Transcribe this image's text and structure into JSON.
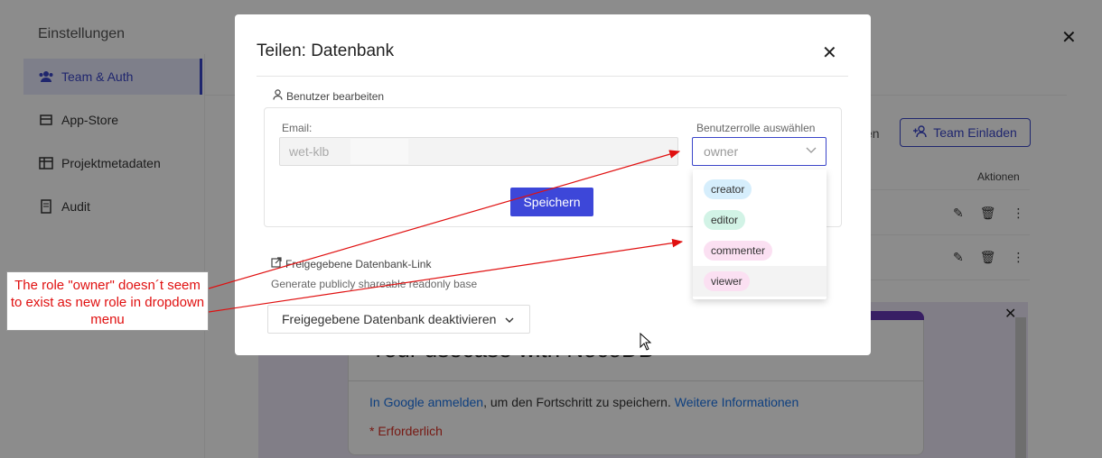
{
  "settings": {
    "title": "Einstellungen",
    "sidebar": [
      {
        "label": "Team & Auth",
        "icon": "team-icon",
        "active": true
      },
      {
        "label": "App-Store",
        "icon": "store-icon",
        "active": false
      },
      {
        "label": "Projektmetadaten",
        "icon": "table-icon",
        "active": false
      },
      {
        "label": "Audit",
        "icon": "audit-icon",
        "active": false
      }
    ],
    "team_button": "Team Einladen",
    "partial_text": "en",
    "actions_header": "Aktionen"
  },
  "form": {
    "heading": "Your usecase with NocoDB",
    "signin_link": "In Google anmelden",
    "signin_text": ", um den Fortschritt zu speichern.",
    "more_link": "Weitere Informationen",
    "required": "* Erforderlich"
  },
  "modal": {
    "title": "Teilen: Datenbank",
    "edit_section": "Benutzer bearbeiten",
    "email_label": "Email:",
    "email_value": "wet-klb",
    "role_label": "Benutzerrolle auswählen",
    "role_value": "owner",
    "save_label": "Speichern",
    "share_section": "Freigegebene Datenbank-Link",
    "share_desc": "Generate publicly shareable readonly base",
    "share_dropdown": "Freigegebene Datenbank deaktivieren"
  },
  "role_options": [
    {
      "label": "creator",
      "color": "#d6eefc"
    },
    {
      "label": "editor",
      "color": "#d2f3e6"
    },
    {
      "label": "commenter",
      "color": "#fbe0f2"
    },
    {
      "label": "viewer",
      "color": "#fbe0f2"
    }
  ],
  "annotation": {
    "text": "The role \"owner\" doesn´t seem to exist as new role in dropdown menu",
    "color": "#e01010"
  }
}
